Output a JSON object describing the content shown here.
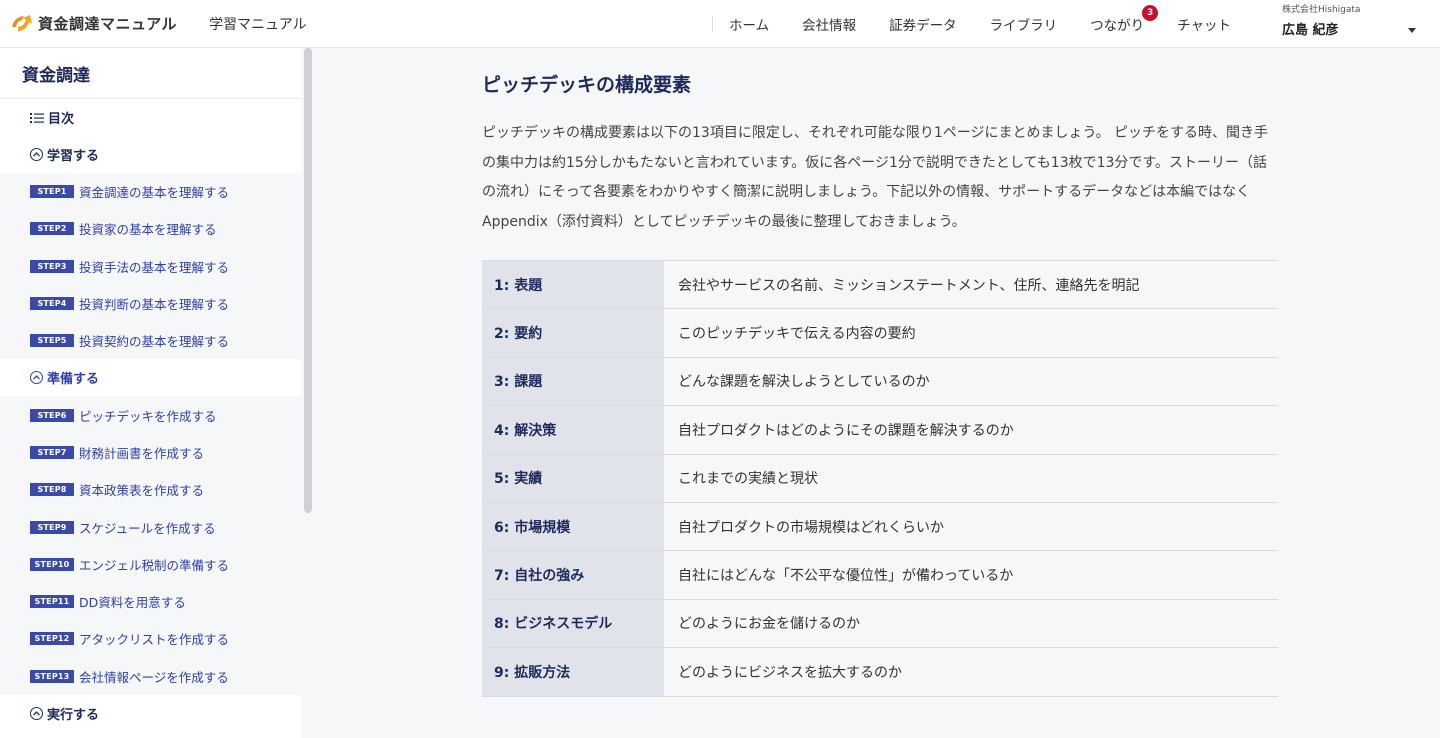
{
  "header": {
    "brand_title": "資金調達マニュアル",
    "subapp": "学習マニュアル",
    "nav": [
      {
        "label": "ホーム"
      },
      {
        "label": "会社情報"
      },
      {
        "label": "証券データ"
      },
      {
        "label": "ライブラリ"
      },
      {
        "label": "つながり",
        "badge": "3"
      },
      {
        "label": "チャット"
      }
    ],
    "company": "株式会社Hishigata",
    "user": "広島 紀彦",
    "accent_color": "#f08c1e",
    "badge_color": "#c8102e"
  },
  "sidebar": {
    "title": "資金調達",
    "toc_label": "目次",
    "sections": [
      {
        "label": "学習する",
        "steps": [
          {
            "badge": "STEP1",
            "label": "資金調達の基本を理解する"
          },
          {
            "badge": "STEP2",
            "label": "投資家の基本を理解する"
          },
          {
            "badge": "STEP3",
            "label": "投資手法の基本を理解する"
          },
          {
            "badge": "STEP4",
            "label": "投資判断の基本を理解する"
          },
          {
            "badge": "STEP5",
            "label": "投資契約の基本を理解する"
          }
        ]
      },
      {
        "label": "準備する",
        "steps": [
          {
            "badge": "STEP6",
            "label": "ピッチデッキを作成する"
          },
          {
            "badge": "STEP7",
            "label": "財務計画書を作成する"
          },
          {
            "badge": "STEP8",
            "label": "資本政策表を作成する"
          },
          {
            "badge": "STEP9",
            "label": "スケジュールを作成する"
          },
          {
            "badge": "STEP10",
            "label": "エンジェル税制の準備する"
          },
          {
            "badge": "STEP11",
            "label": "DD資料を用意する"
          },
          {
            "badge": "STEP12",
            "label": "アタックリストを作成する"
          },
          {
            "badge": "STEP13",
            "label": "会社情報ページを作成する"
          }
        ]
      },
      {
        "label": "実行する",
        "steps": []
      }
    ]
  },
  "main": {
    "title": "ピッチデッキの構成要素",
    "intro": "ピッチデッキの構成要素は以下の13項目に限定し、それぞれ可能な限り1ページにまとめましょう。 ピッチをする時、聞き手の集中力は約15分しかもたないと言われています。仮に各ページ1分で説明できたとしても13枚で13分です。ストーリー（話の流れ）にそって各要素をわかりやすく簡潔に説明しましょう。下記以外の情報、サポートするデータなどは本編ではなくAppendix（添付資料）としてピッチデッキの最後に整理しておきましょう。",
    "table": [
      {
        "key": "1: 表題",
        "value": "会社やサービスの名前、ミッションステートメント、住所、連絡先を明記"
      },
      {
        "key": "2: 要約",
        "value": "このピッチデッキで伝える内容の要約"
      },
      {
        "key": "3: 課題",
        "value": "どんな課題を解決しようとしているのか"
      },
      {
        "key": "4: 解決策",
        "value": "自社プロダクトはどのようにその課題を解決するのか"
      },
      {
        "key": "5: 実績",
        "value": "これまでの実績と現状"
      },
      {
        "key": "6: 市場規模",
        "value": "自社プロダクトの市場規模はどれくらいか"
      },
      {
        "key": "7: 自社の強み",
        "value": "自社にはどんな「不公平な優位性」が備わっているか"
      },
      {
        "key": "8: ビジネスモデル",
        "value": "どのようにお金を儲けるのか"
      },
      {
        "key": "9: 拡販方法",
        "value": "どのようにビジネスを拡大するのか"
      }
    ]
  }
}
